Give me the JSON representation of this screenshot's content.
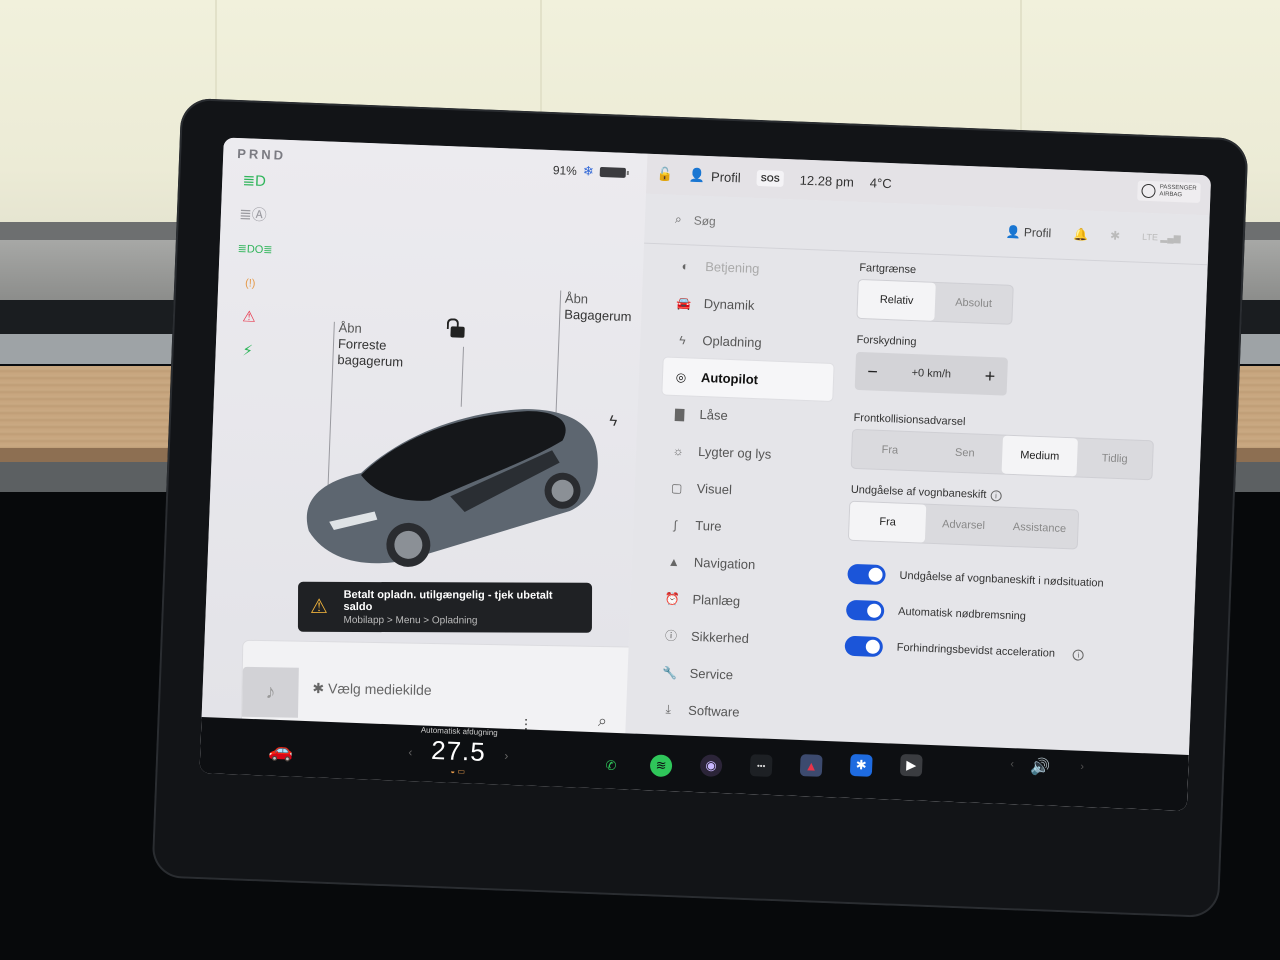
{
  "car_panel": {
    "gear": "PRND",
    "battery_percent": "91%",
    "battery_level": 0.91,
    "telltales": [
      {
        "name": "headlight-icon",
        "glyph": "≣D",
        "color": "#2fb55a"
      },
      {
        "name": "auto-headlight-icon",
        "glyph": "≣Ⓐ",
        "color": "#9a9aa0"
      },
      {
        "name": "parking-light-icon",
        "glyph": "≣DO≣",
        "color": "#2fb55a"
      },
      {
        "name": "tire-pressure-icon",
        "glyph": "(!)",
        "color": "#e59a4a"
      },
      {
        "name": "seatbelt-icon",
        "glyph": "⚠",
        "color": "#e8344a"
      },
      {
        "name": "charging-icon",
        "glyph": "⚡",
        "color": "#2fb55a"
      }
    ],
    "frunk_callout": {
      "line1": "Åbn",
      "line2": "Forreste",
      "line3": "bagagerum"
    },
    "trunk_callout": {
      "line1": "Åbn",
      "line2": "Bagagerum"
    },
    "alert": {
      "title": "Betalt opladn. utilgængelig - tjek ubetalt saldo",
      "subtitle": "Mobilapp > Menu > Opladning"
    },
    "media": {
      "source_label": "Vælg mediekilde",
      "page_dots": "• • •"
    }
  },
  "topbar": {
    "profile": "Profil",
    "sos": "SOS",
    "time": "12.28 pm",
    "temperature": "4°C",
    "airbag_line1": "PASSENGER",
    "airbag_line2": "AIRBAG"
  },
  "settings": {
    "search_placeholder": "Søg",
    "profile": "Profil",
    "nav": [
      {
        "label": "Betjening",
        "icon": "toggle-icon",
        "glyph": "◐",
        "active": false
      },
      {
        "label": "Dynamik",
        "icon": "car-icon",
        "glyph": "🚘",
        "active": false
      },
      {
        "label": "Opladning",
        "icon": "bolt-icon",
        "glyph": "ϟ",
        "active": false
      },
      {
        "label": "Autopilot",
        "icon": "steering-wheel-icon",
        "glyph": "◎",
        "active": true
      },
      {
        "label": "Låse",
        "icon": "lock-icon",
        "glyph": "▇",
        "active": false
      },
      {
        "label": "Lygter og lys",
        "icon": "sun-icon",
        "glyph": "☼",
        "active": false
      },
      {
        "label": "Visuel",
        "icon": "display-icon",
        "glyph": "▢",
        "active": false
      },
      {
        "label": "Ture",
        "icon": "trips-icon",
        "glyph": "∫",
        "active": false
      },
      {
        "label": "Navigation",
        "icon": "navigation-icon",
        "glyph": "▲",
        "active": false
      },
      {
        "label": "Planlæg",
        "icon": "alarm-clock-icon",
        "glyph": "⏰",
        "active": false
      },
      {
        "label": "Sikkerhed",
        "icon": "alert-circle-icon",
        "glyph": "ⓘ",
        "active": false
      },
      {
        "label": "Service",
        "icon": "wrench-icon",
        "glyph": "🔧",
        "active": false
      },
      {
        "label": "Software",
        "icon": "download-icon",
        "glyph": "⤓",
        "active": false
      }
    ],
    "speed_limit": {
      "label": "Fartgrænse",
      "options": [
        "Relativ",
        "Absolut"
      ],
      "selected": "Relativ"
    },
    "offset": {
      "label": "Forskydning",
      "value": "+0 km/h",
      "minus": "−",
      "plus": "+"
    },
    "forward_collision": {
      "label": "Frontkollisionsadvarsel",
      "options": [
        "Fra",
        "Sen",
        "Medium",
        "Tidlig"
      ],
      "selected": "Medium"
    },
    "lane_departure": {
      "label": "Undgåelse af vognbaneskift",
      "options": [
        "Fra",
        "Advarsel",
        "Assistance"
      ],
      "selected": "Fra"
    },
    "toggles": [
      {
        "label": "Undgåelse af vognbaneskift i nødsituation",
        "on": true,
        "info": false
      },
      {
        "label": "Automatisk nødbremsning",
        "on": true,
        "info": false
      },
      {
        "label": "Forhindringsbevidst acceleration",
        "on": true,
        "info": true
      }
    ],
    "accent_color": "#1b55d9"
  },
  "dock": {
    "climate_label": "Automatisk afdugning",
    "climate_temp": "27.5",
    "apps": [
      {
        "name": "phone-icon",
        "glyph": "✆",
        "color": "#2fc65a",
        "bg": "transparent"
      },
      {
        "name": "spotify-icon",
        "glyph": "≋",
        "color": "#0d0f12",
        "bg": "#2fc65a"
      },
      {
        "name": "camera-icon",
        "glyph": "◉",
        "color": "#c9b8ff",
        "bg": "#2b2438"
      },
      {
        "name": "more-apps-icon",
        "glyph": "•••",
        "color": "#ddd",
        "bg": "#1d2024"
      },
      {
        "name": "navigation-app-icon",
        "glyph": "▲",
        "color": "#e8344a",
        "bg": "#3c4a6e"
      },
      {
        "name": "bluetooth-icon",
        "glyph": "✱",
        "color": "#fff",
        "bg": "#1e6be0"
      },
      {
        "name": "theater-icon",
        "glyph": "▶",
        "color": "#fff",
        "bg": "#3a3c40"
      }
    ]
  }
}
